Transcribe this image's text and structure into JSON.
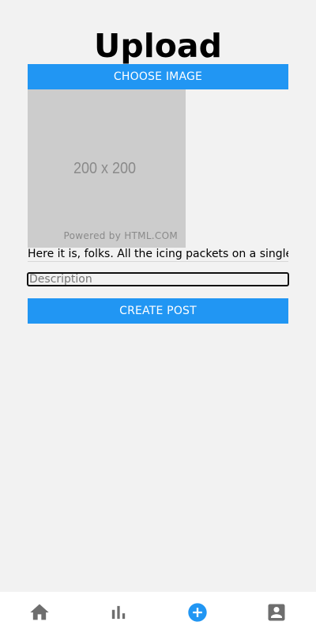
{
  "header": {
    "title": "Upload"
  },
  "upload_form": {
    "choose_image_label": "CHOOSE IMAGE",
    "image_placeholder": {
      "size_text": "200 x 200",
      "credit_text": "Powered by HTML.COM"
    },
    "caption_value": "Here it is, folks. All the icing packets on a single",
    "description_placeholder": "Description",
    "description_value": "",
    "create_post_label": "CREATE POST"
  },
  "bottom_nav": {
    "items": [
      {
        "icon": "home-icon",
        "active": false
      },
      {
        "icon": "bar-chart-icon",
        "active": false
      },
      {
        "icon": "add-circle-icon",
        "active": true
      },
      {
        "icon": "account-box-icon",
        "active": false
      }
    ]
  },
  "colors": {
    "accent": "#2196f3",
    "nav_icon": "#6e6e6e",
    "background": "#f2f2f2",
    "placeholder_bg": "#cccccc"
  }
}
